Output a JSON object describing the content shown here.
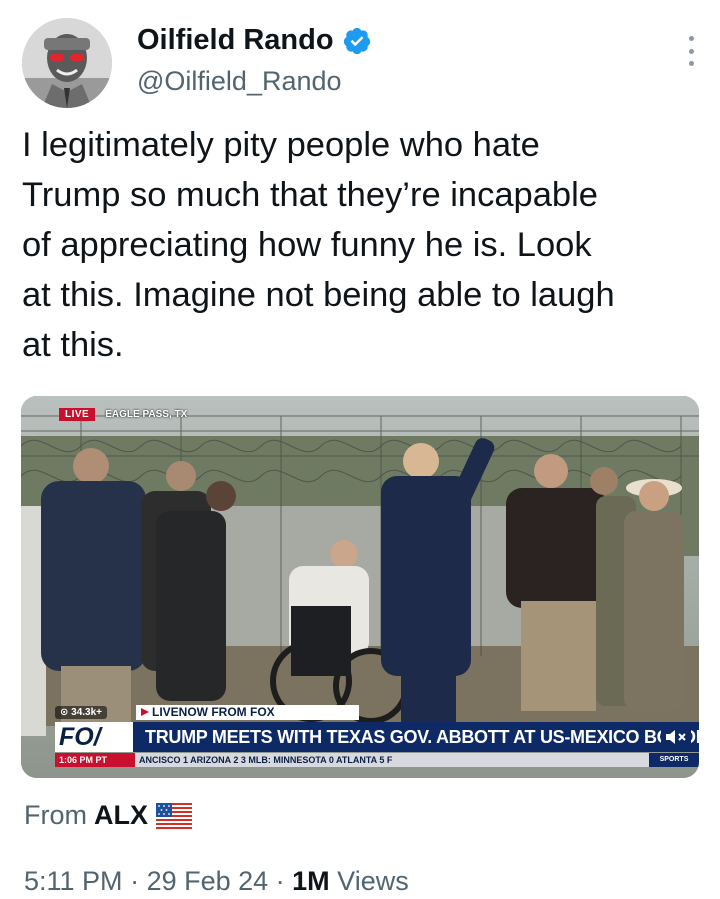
{
  "author": {
    "display_name": "Oilfield Rando",
    "handle": "@Oilfield_Rando",
    "verified_icon": "verified-badge-icon",
    "avatar_icon": "avatar-photo"
  },
  "tweet": {
    "text": "I legitimately pity people who hate\nTrump so much that they’re incapable\nof appreciating how funny he is. Look\nat this. Imagine not being able to laugh\nat this."
  },
  "video": {
    "live_label": "LIVE",
    "location": "EAGLE PASS, TX",
    "views_badge": "⊙ 34.3k+",
    "livenow": "LIVENOW FROM FOX",
    "logo": "FO/",
    "headline": "TRUMP MEETS WITH TEXAS GOV. ABBOTT AT US-MEXICO BORDER",
    "ticker_time": "1:06 PM PT",
    "ticker_text": "ANCISCO  1  ARIZONA  2  3    MLB:  MINNESOTA  0  ATLANTA  5  F",
    "sports_label": "SPORTS"
  },
  "source": {
    "prefix": "From",
    "name": "ALX",
    "flag_icon": "us-flag-icon"
  },
  "meta": {
    "time": "5:11 PM",
    "separator": " · ",
    "date": "29 Feb 24",
    "views_count": "1M",
    "views_label": " Views"
  },
  "colors": {
    "verified_blue": "#1d9bf0",
    "text_primary": "#0f1419",
    "text_secondary": "#536471",
    "fox_navy": "#0d2a66",
    "live_red": "#c8102e"
  }
}
